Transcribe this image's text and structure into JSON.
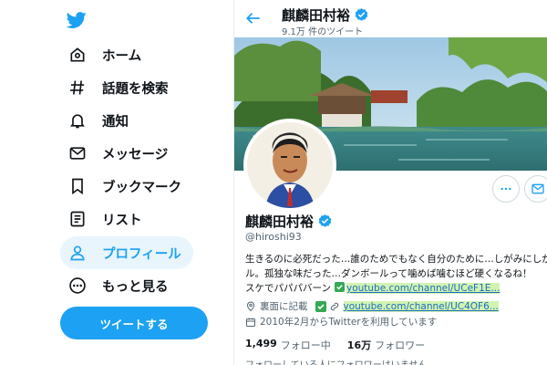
{
  "colors": {
    "accent": "#1da1f2",
    "active_bg": "#e8f5fd",
    "link": "#1b6dc1",
    "link_highlight": "#d2f3b1"
  },
  "sidebar": {
    "logo_icon": "twitter-bird-icon",
    "items": [
      {
        "label": "ホーム",
        "icon": "home-icon"
      },
      {
        "label": "話題を検索",
        "icon": "hashtag-icon"
      },
      {
        "label": "通知",
        "icon": "bell-icon"
      },
      {
        "label": "メッセージ",
        "icon": "mail-icon"
      },
      {
        "label": "ブックマーク",
        "icon": "bookmark-icon"
      },
      {
        "label": "リスト",
        "icon": "list-icon"
      },
      {
        "label": "プロフィール",
        "icon": "user-icon",
        "active": true
      },
      {
        "label": "もっと見る",
        "icon": "more-icon"
      }
    ],
    "tweet_button": "ツイートする"
  },
  "header": {
    "name": "麒麟田村裕",
    "tweet_count": "9.1万 件のツイート"
  },
  "profile": {
    "name": "麒麟田村裕",
    "handle": "@hiroshi93",
    "bio": {
      "line1": "生きるのに必死だった…誰のためでもなく自分のために…しがみにしがみつ",
      "line2": "ル。孤独な味だった…ダンボールって噛めば噛むほど硬くなるね！",
      "line3": "スケでパパパバーン",
      "link1": "youtube.com/channel/UCeF1E..."
    },
    "location": "裏面に記載",
    "website": "youtube.com/channel/UC4OF6...",
    "joined": "2010年2月からTwitterを利用しています",
    "following_count": "1,499",
    "following_label": "フォロー中",
    "followers_count": "16万",
    "followers_label": "フォロワー",
    "followers_you_know": "フォローしている人にフォロワーはいません"
  }
}
